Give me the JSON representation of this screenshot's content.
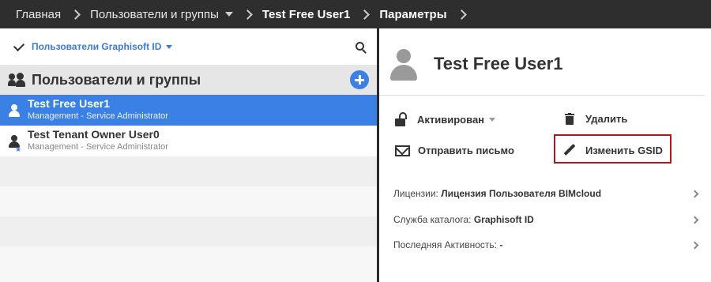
{
  "breadcrumb": {
    "home": "Главная",
    "users_groups": "Пользователи и группы",
    "user": "Test Free User1",
    "params": "Параметры"
  },
  "left": {
    "filter_label": "Пользователи Graphisoft ID",
    "group_title": "Пользователи и группы",
    "users": [
      {
        "name": "Test Free User1",
        "role": "Management - Service Administrator",
        "selected": true
      },
      {
        "name": "Test Tenant Owner User0",
        "role": "Management - Service Administrator",
        "selected": false
      }
    ]
  },
  "right": {
    "title": "Test Free User1",
    "actions": {
      "status": "Активирован",
      "delete": "Удалить",
      "send_mail": "Отправить письмо",
      "edit_gsid": "Изменить GSID"
    },
    "info": {
      "license_label": "Лицензии:",
      "license_value": "Лицензия Пользователя BIMcloud",
      "catalog_label": "Служба каталога:",
      "catalog_value": "Graphisoft ID",
      "activity_label": "Последняя Активность:",
      "activity_value": "-"
    }
  },
  "colors": {
    "topbar": "#2e2e2e",
    "accent": "#3b80e5",
    "highlight_border": "#a61c1c"
  }
}
